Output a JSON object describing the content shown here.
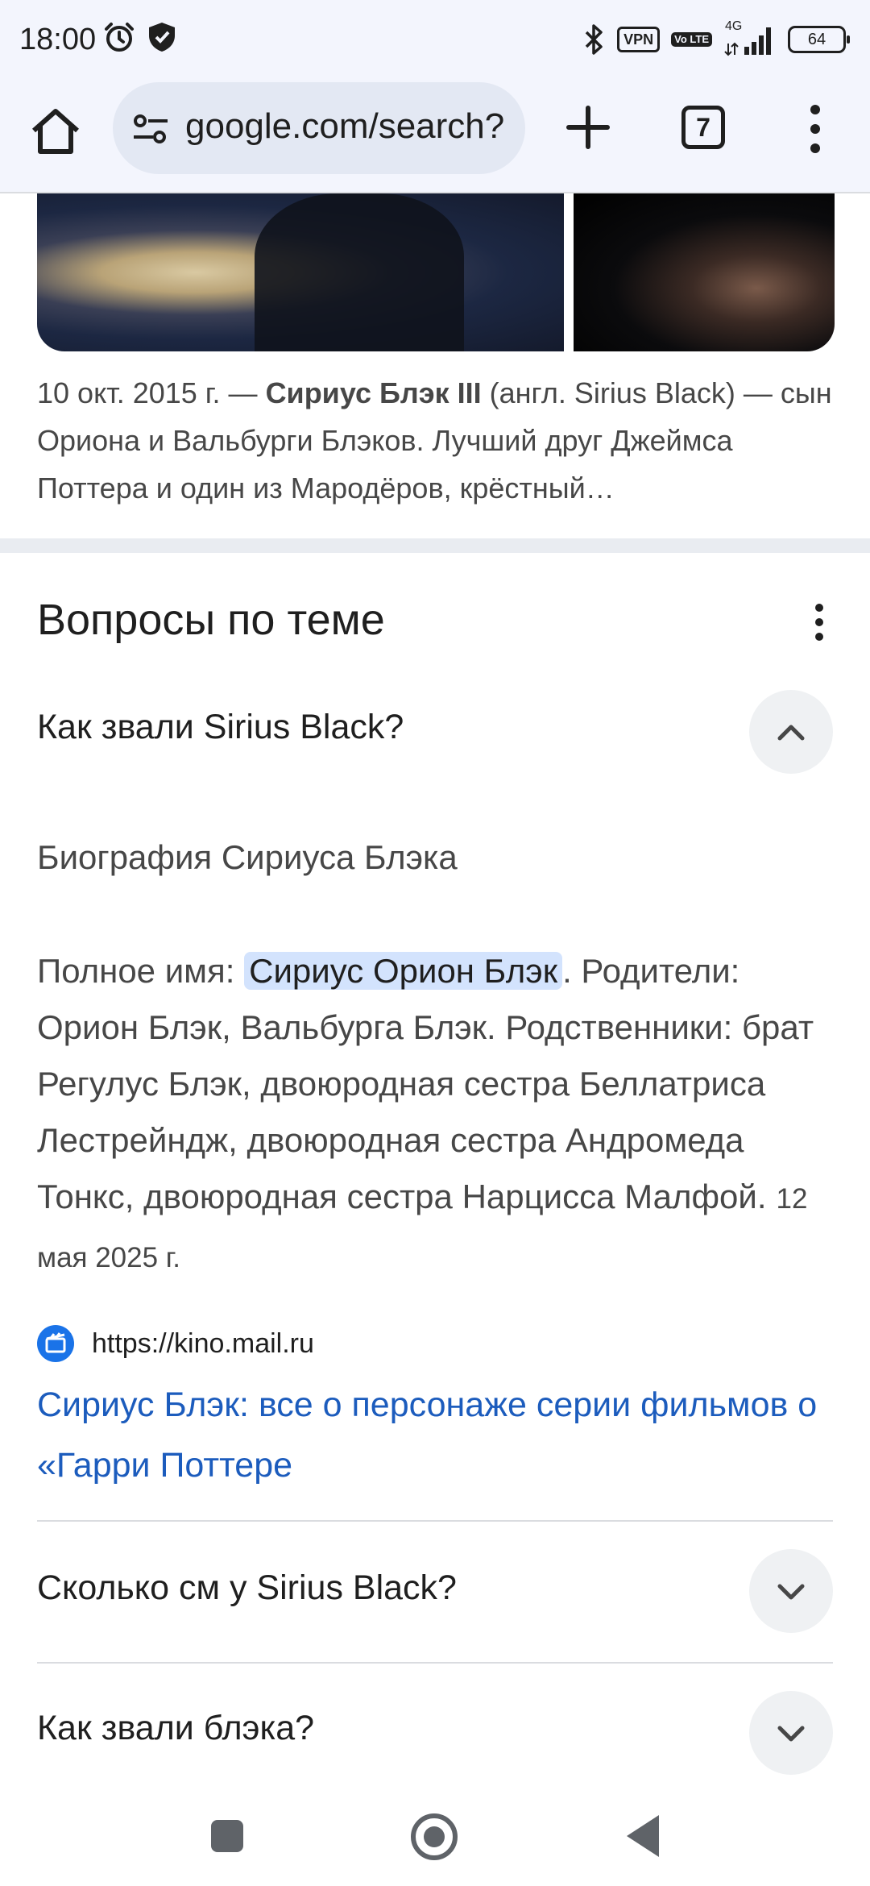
{
  "status_bar": {
    "time": "18:00",
    "vpn_label": "VPN",
    "volte_label": "Vo LTE",
    "network_label": "4G",
    "battery_level": "64"
  },
  "toolbar": {
    "url": "google.com/search?",
    "tab_count": "7"
  },
  "result_snippet": {
    "date": "10 окт. 2015 г. — ",
    "bold_name": "Сириус Блэк III",
    "text": " (англ. Sirius Black) — сын Ориона и Вальбурги Блэков. Лучший друг Джеймса Поттера и один из Мародёров, крёстный…"
  },
  "related_questions": {
    "title": "Вопросы по теме",
    "items": [
      {
        "question": "Как звали Sirius Black?",
        "expanded": true,
        "answer_heading": "Биография Сириуса Блэка",
        "answer_prefix": "Полное имя: ",
        "answer_highlight": "Сириус Орион Блэк",
        "answer_rest": ". Родители: Орион Блэк, Вальбурга Блэк. Родственники: брат Регулус Блэк, двоюродная сестра Беллатриса Лестрейндж, двоюродная сестра Андромеда Тонкс, двоюродная сестра Нарцисса Малфой.",
        "answer_date": "12 мая 2025 г.",
        "source_url": "https://kino.mail.ru",
        "source_title": "Сириус Блэк: все о персонаже серии фильмов о «Гарри Поттере"
      },
      {
        "question": "Сколько см у Sirius Black?",
        "expanded": false
      },
      {
        "question": "Как звали блэка?",
        "expanded": false
      }
    ]
  },
  "icons": {
    "home": "home-icon",
    "site_settings": "tune-icon",
    "new_tab": "plus-icon",
    "menu": "more-vert-icon",
    "expand_less": "chevron-up-icon",
    "expand_more": "chevron-down-icon"
  }
}
